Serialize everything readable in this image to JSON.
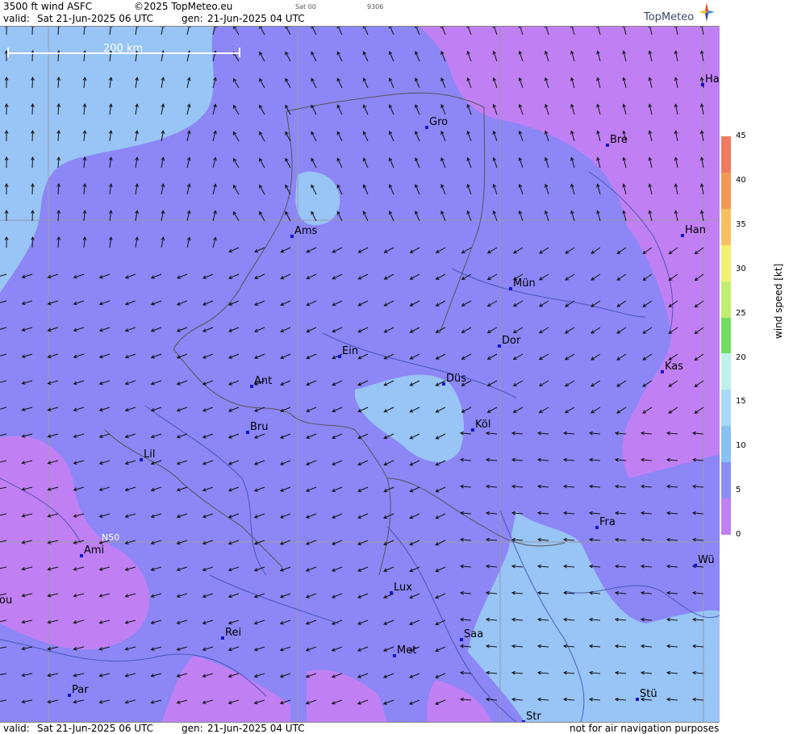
{
  "header": {
    "product": "3500 ft wind ASFC",
    "copyright": "©2025 TopMeteo.eu",
    "small_day": "Sat 00",
    "small_code": "9306",
    "valid_label": "valid:",
    "valid_time": "Sat  21-Jun-2025  06 UTC",
    "gen_label": "gen:",
    "gen_time": "21-Jun-2025 04 UTC",
    "brand": "TopMeteo"
  },
  "footer": {
    "valid_label": "valid:",
    "valid_time": "Sat  21-Jun-2025  06 UTC",
    "gen_label": "gen:",
    "gen_time": "21-Jun-2025 04 UTC",
    "disclaimer": "not for air navigation purposes"
  },
  "map": {
    "scale_label": "200 km",
    "graticule_label": "N50",
    "cities": [
      "Ha",
      "Gro",
      "Bre",
      "Ams",
      "Han",
      "Mün",
      "Dor",
      "Ein",
      "Kas",
      "Ant",
      "Düs",
      "Köl",
      "Bru",
      "Lil",
      "Fra",
      "Ami",
      "Wü",
      "ou",
      "Lux",
      "Saa",
      "Rei",
      "Met",
      "Par",
      "Stü",
      "Str"
    ]
  },
  "colorbar": {
    "title": "wind speed [kt]",
    "ticks": [
      "45",
      "40",
      "35",
      "30",
      "25",
      "20",
      "15",
      "10",
      "5",
      "0"
    ],
    "colors": [
      "#f07a60",
      "#f29a55",
      "#f6c060",
      "#f2f070",
      "#c0ee70",
      "#70dd60",
      "#c0f0ee",
      "#a8d8f8",
      "#88c0f2",
      "#8c8cf8",
      "#c080f4"
    ]
  }
}
